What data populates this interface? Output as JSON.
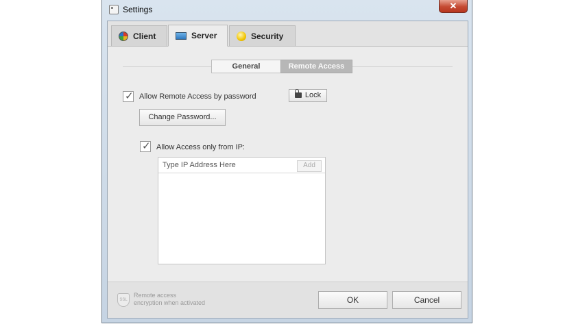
{
  "window": {
    "title": "Settings",
    "close_symbol": "✕",
    "app_icon": "settings-window-icon"
  },
  "tabs": [
    {
      "label": "Client",
      "icon": "client-color-wheel-icon",
      "active": false
    },
    {
      "label": "Server",
      "icon": "server-monitor-icon",
      "active": true
    },
    {
      "label": "Security",
      "icon": "security-bulb-icon",
      "active": false
    }
  ],
  "subtabs": [
    {
      "label": "General",
      "active": false
    },
    {
      "label": "Remote Access",
      "active": true
    }
  ],
  "remote": {
    "allow_password_label": "Allow Remote Access by password",
    "allow_password_checked": true,
    "lock_label": "Lock",
    "change_password_label": "Change Password...",
    "allow_ip_label": "Allow Access only from IP:",
    "allow_ip_checked": true,
    "ip_placeholder": "Type IP Address Here",
    "ip_value": "",
    "add_label": "Add",
    "ip_list": []
  },
  "footer": {
    "ssl_icon_text": "SSL",
    "note_line1": "Remote access",
    "note_line2": "encryption when activated",
    "ok_label": "OK",
    "cancel_label": "Cancel"
  },
  "colors": {
    "close_button": "#c44a32",
    "active_subtab": "#b7b7b7",
    "frame": "#c6d4e3"
  }
}
